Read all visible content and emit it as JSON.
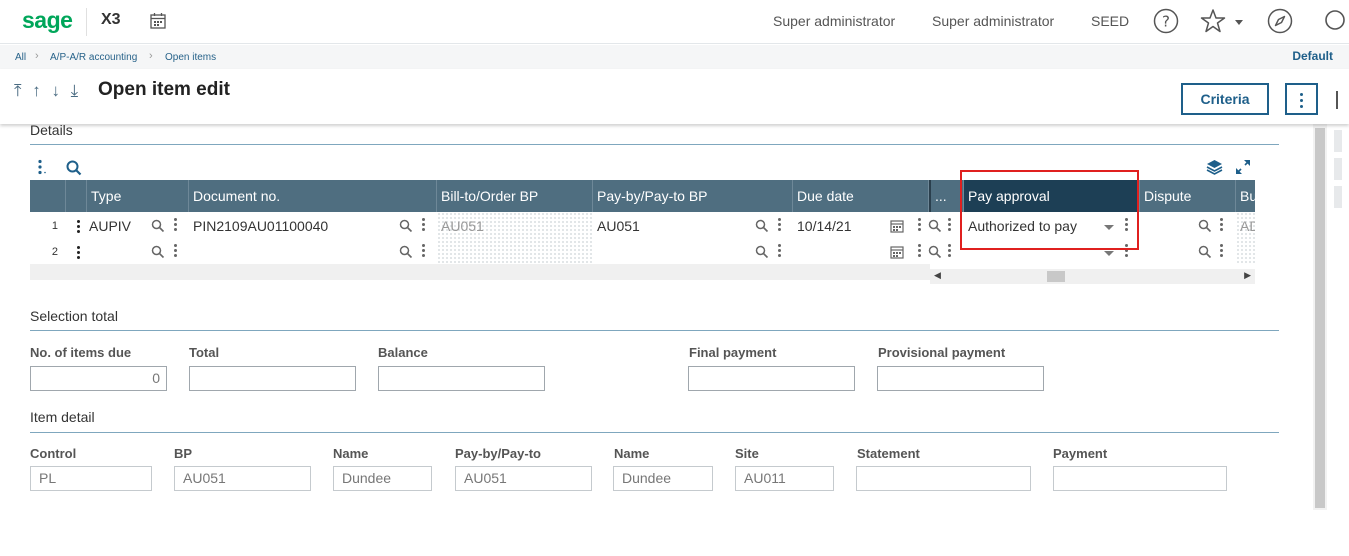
{
  "topbar": {
    "logo": "sage",
    "product": "X3",
    "user1": "Super administrator",
    "user2": "Super administrator",
    "folder": "SEED"
  },
  "breadcrumb": {
    "items": [
      "All",
      "A/P-A/R accounting",
      "Open items"
    ],
    "default_label": "Default"
  },
  "header": {
    "nav_arrows": "⤒ ↑ ↓ ⤓",
    "title": "Open item edit",
    "criteria_label": "Criteria"
  },
  "details": {
    "title": "Details",
    "columns": [
      "",
      "",
      "Type",
      "Document no.",
      "Bill-to/Order BP",
      "Pay-by/Pay-to BP",
      "Due date",
      "...",
      "Pay approval",
      "Dispute",
      "Bu"
    ],
    "rows": [
      {
        "num": "1",
        "type": "AUPIV",
        "document_no": "PIN2109AU01100040",
        "bill_to": "AU051",
        "pay_by": "AU051",
        "due_date": "10/14/21",
        "pay_approval": "Authorized to pay",
        "bu": "AD"
      },
      {
        "num": "2",
        "type": "",
        "document_no": "",
        "bill_to": "",
        "pay_by": "",
        "due_date": "",
        "pay_approval": "",
        "bu": ""
      }
    ]
  },
  "selection_total": {
    "title": "Selection total",
    "no_items_label": "No. of items due",
    "no_items_value": "0",
    "total_label": "Total",
    "total_value": "",
    "balance_label": "Balance",
    "balance_value": "",
    "final_payment_label": "Final payment",
    "final_payment_value": "",
    "provisional_payment_label": "Provisional payment",
    "provisional_payment_value": ""
  },
  "item_detail": {
    "title": "Item detail",
    "control_label": "Control",
    "control_value": "PL",
    "bp_label": "BP",
    "bp_value": "AU051",
    "name1_label": "Name",
    "name1_value": "Dundee",
    "payby_label": "Pay-by/Pay-to",
    "payby_value": "AU051",
    "name2_label": "Name",
    "name2_value": "Dundee",
    "site_label": "Site",
    "site_value": "AU011",
    "statement_label": "Statement",
    "statement_value": "",
    "payment_label": "Payment",
    "payment_value": ""
  },
  "colors": {
    "brand": "#00a65a",
    "accent": "#1e5f8a",
    "grid_header": "#4f6e80",
    "grid_header_active": "#1d3f55",
    "highlight": "#e0201f"
  }
}
